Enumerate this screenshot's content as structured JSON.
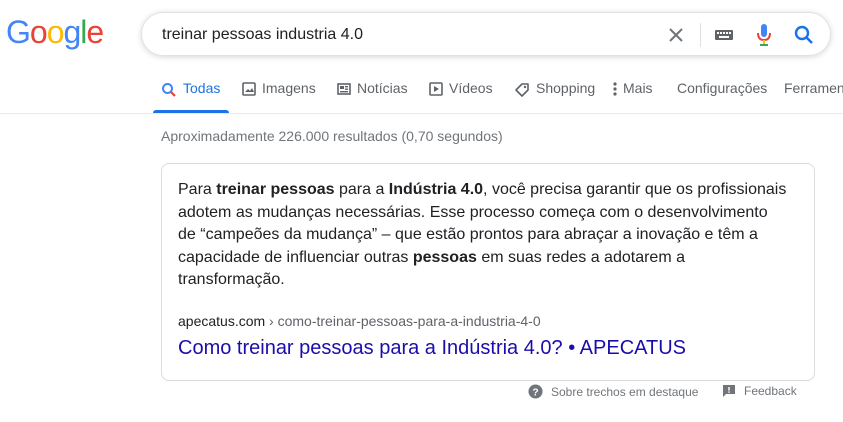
{
  "logo": {
    "letters": [
      "G",
      "o",
      "o",
      "g",
      "l",
      "e"
    ],
    "colors": [
      "#4285F4",
      "#EA4335",
      "#FBBC05",
      "#4285F4",
      "#34A853",
      "#EA4335"
    ]
  },
  "search": {
    "value": "treinar pessoas industria 4.0",
    "clear_icon": "close-icon",
    "keyboard_icon": "keyboard-icon",
    "voice_icon": "microphone-icon",
    "search_icon": "search-icon"
  },
  "tabs": [
    {
      "label": "Todas",
      "icon": "search-icon",
      "active": true
    },
    {
      "label": "Imagens",
      "icon": "image-icon"
    },
    {
      "label": "Notícias",
      "icon": "newspaper-icon"
    },
    {
      "label": "Vídeos",
      "icon": "play-icon"
    },
    {
      "label": "Shopping",
      "icon": "tag-icon"
    },
    {
      "label": "Mais",
      "icon": "more-vert-icon"
    },
    {
      "label": "Configurações"
    },
    {
      "label": "Ferramentas"
    }
  ],
  "result_stats": "Aproximadamente 226.000 resultados (0,70 segundos)",
  "featured_snippet": {
    "parts": [
      {
        "text": "Para ",
        "bold": false
      },
      {
        "text": "treinar pessoas",
        "bold": true
      },
      {
        "text": " para a ",
        "bold": false
      },
      {
        "text": "Indústria 4.0",
        "bold": true
      },
      {
        "text": ", você precisa garantir que os profissionais adotem as mudanças necessárias. Esse processo começa com o desenvolvimento de “campeões da mudança” – que estão prontos para abraçar a inovação e têm a capacidade de influenciar outras ",
        "bold": false
      },
      {
        "text": "pessoas",
        "bold": true
      },
      {
        "text": " em suas redes a adotarem a transformação.",
        "bold": false
      }
    ],
    "cite_domain": "apecatus.com",
    "cite_path": " › como-treinar-pessoas-para-a-industria-4-0",
    "title": "Como treinar pessoas para a Indústria 4.0? • APECATUS"
  },
  "footer": {
    "about_label": "Sobre trechos em destaque",
    "feedback_label": "Feedback"
  },
  "colors": {
    "accent": "#1a73e8",
    "link": "#1a0dab",
    "muted": "#70757a"
  }
}
